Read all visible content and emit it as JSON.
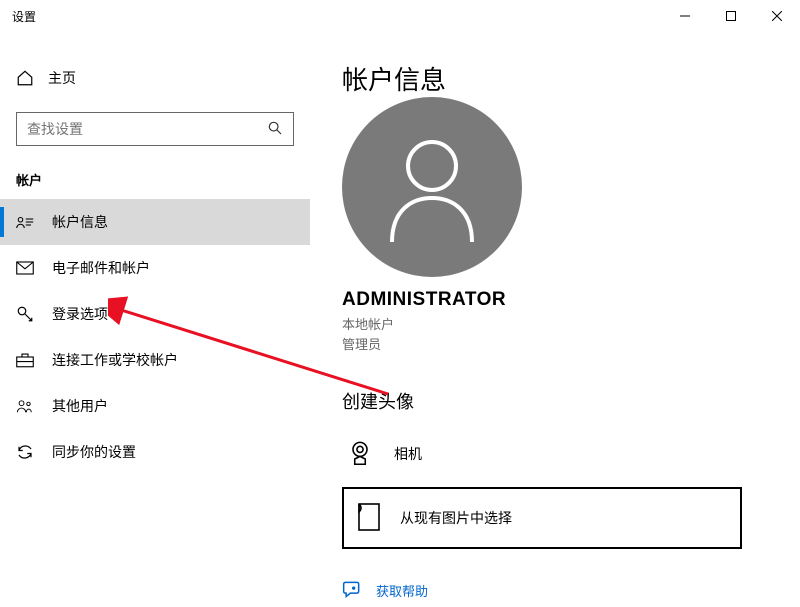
{
  "window": {
    "title": "设置"
  },
  "sidebar": {
    "home_label": "主页",
    "search_placeholder": "查找设置",
    "section_label": "帐户",
    "items": [
      {
        "label": "帐户信息"
      },
      {
        "label": "电子邮件和帐户"
      },
      {
        "label": "登录选项"
      },
      {
        "label": "连接工作或学校帐户"
      },
      {
        "label": "其他用户"
      },
      {
        "label": "同步你的设置"
      }
    ]
  },
  "main": {
    "heading": "帐户信息",
    "username": "ADMINISTRATOR",
    "account_type_line1": "本地帐户",
    "account_type_line2": "管理员",
    "create_avatar_title": "创建头像",
    "camera_label": "相机",
    "browse_label": "从现有图片中选择",
    "help_label": "获取帮助"
  }
}
